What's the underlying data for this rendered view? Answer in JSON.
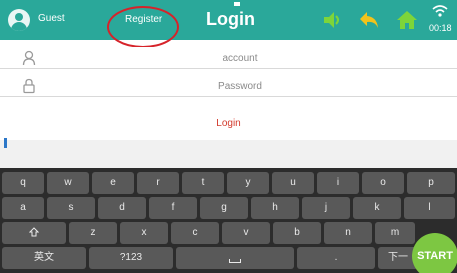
{
  "header": {
    "guest_label": "Guest",
    "register_label": "Register",
    "title": "Login",
    "time": "00:18",
    "icons": [
      "speaker-icon",
      "back-arrow-icon",
      "home-icon",
      "wifi-icon"
    ],
    "color": "#2aa89a"
  },
  "form": {
    "account_placeholder": "account",
    "password_placeholder": "Password",
    "login_label": "Login",
    "icons": [
      "user-icon",
      "lock-icon"
    ]
  },
  "keyboard": {
    "row1": [
      "q",
      "w",
      "e",
      "r",
      "t",
      "y",
      "u",
      "i",
      "o",
      "p"
    ],
    "row2": [
      "a",
      "s",
      "d",
      "f",
      "g",
      "h",
      "j",
      "k",
      "l"
    ],
    "row3": [
      "z",
      "x",
      "c",
      "v",
      "b",
      "n",
      "m"
    ],
    "shift_icon": "shift-icon",
    "lang_label": "英文",
    "symbols_label": "?123",
    "dot_label": ".",
    "next_label": "下一"
  },
  "start_button": "START"
}
